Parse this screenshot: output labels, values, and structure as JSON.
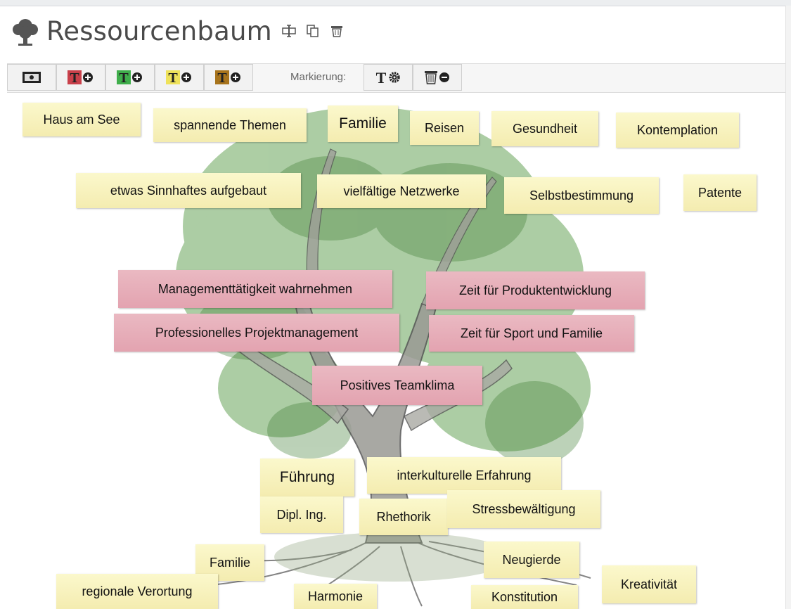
{
  "app": {
    "title": "Ressourcenbaum",
    "title_icons": [
      "rename-icon",
      "copy-icon",
      "trash-icon"
    ]
  },
  "toolbar": {
    "marking_label": "Markierung:",
    "buttons": [
      {
        "name": "image-button",
        "icon": "photo-icon"
      },
      {
        "name": "add-red-note-button",
        "icon": "text-plus-icon",
        "color": "#c9404a"
      },
      {
        "name": "add-green-note-button",
        "icon": "text-plus-icon",
        "color": "#3fae4b"
      },
      {
        "name": "add-yellow-note-button",
        "icon": "text-plus-icon",
        "color": "#efe25a"
      },
      {
        "name": "add-brown-note-button",
        "icon": "text-plus-icon",
        "color": "#a8741c"
      },
      {
        "name": "marking-settings-button",
        "icon": "text-gear-icon"
      },
      {
        "name": "marking-delete-button",
        "icon": "trash-minus-icon"
      }
    ]
  },
  "colors": {
    "yellow_note": "#f7f1c0",
    "red_note": "#e6aeb9",
    "accent_red": "#c9404a",
    "accent_green": "#3fae4b",
    "accent_yellow": "#efe25a",
    "accent_brown": "#a8741c"
  },
  "notes": {
    "haus_am_see": "Haus am See",
    "spannende_themen": "spannende Themen",
    "familie_top": "Familie",
    "reisen": "Reisen",
    "gesundheit": "Gesundheit",
    "kontemplation": "Kontemplation",
    "sinnhaftes": "etwas Sinnhaftes aufgebaut",
    "netzwerke": "vielfältige Netzwerke",
    "selbstbestimmung": "Selbstbestimmung",
    "patente": "Patente",
    "management": "Managementtätigkeit wahrnehmen",
    "produktentwicklung": "Zeit für Produktentwicklung",
    "projektmanagement": "Professionelles Projektmanagement",
    "sport_familie": "Zeit für Sport und Familie",
    "teamklima": "Positives Teamklima",
    "fuehrung": "Führung",
    "interkulturell": "interkulturelle Erfahrung",
    "dipl_ing": "Dipl. Ing.",
    "rhethorik": "Rhethorik",
    "stress": "Stressbewältigung",
    "familie_bottom": "Familie",
    "neugierde": "Neugierde",
    "kreativitaet": "Kreativität",
    "regionale": "regionale Verortung",
    "harmonie": "Harmonie",
    "konstitution": "Konstitution"
  }
}
